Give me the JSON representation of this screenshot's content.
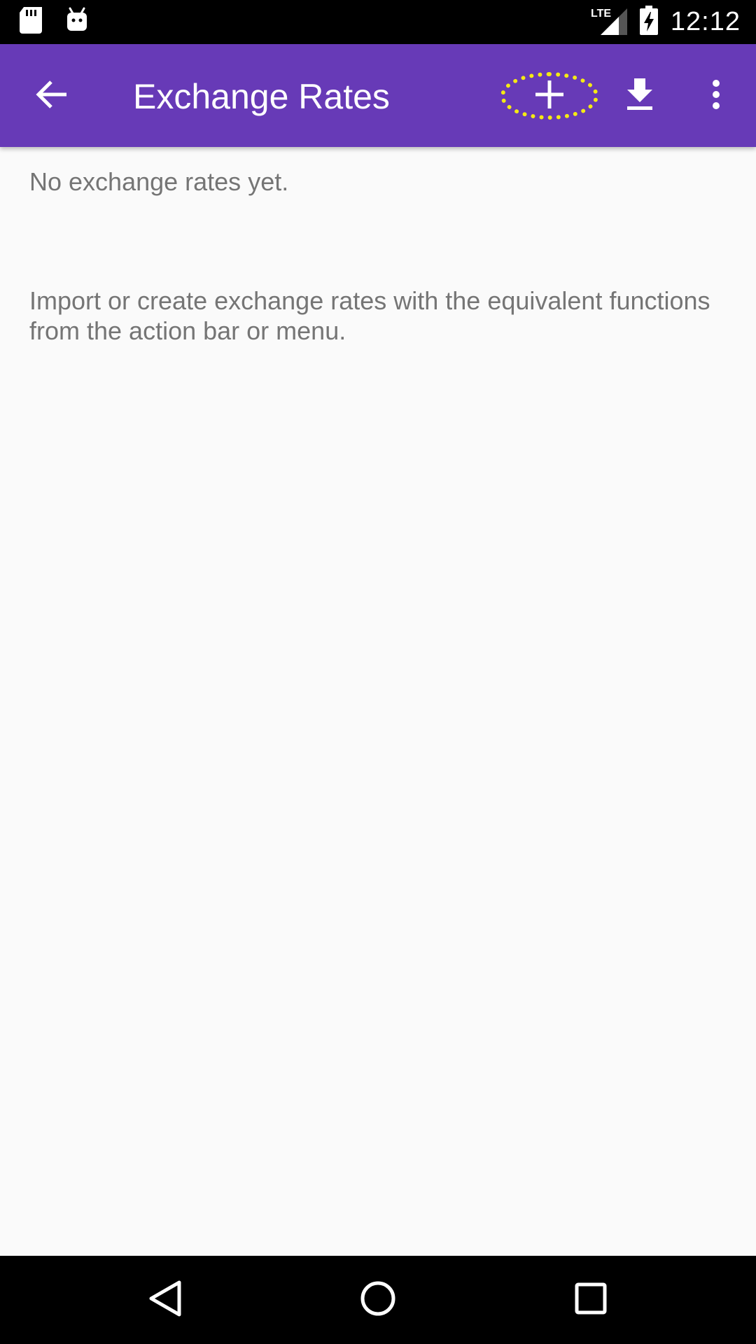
{
  "status_bar": {
    "time": "12:12",
    "network": "LTE",
    "icons": [
      "sd-card-icon",
      "android-icon",
      "signal-icon",
      "battery-charging-icon"
    ]
  },
  "app_bar": {
    "title": "Exchange Rates",
    "background_color": "#673ab7",
    "actions": [
      "back-arrow-icon",
      "add-icon",
      "download-icon",
      "more-vert-icon"
    ],
    "highlight_color": "#f5ea14"
  },
  "content": {
    "empty_title": "No exchange rates yet.",
    "empty_hint": "Import or create exchange rates with the equivalent functions from the action bar or menu."
  },
  "nav_bar": {
    "buttons": [
      "back-triangle-icon",
      "home-circle-icon",
      "recents-square-icon"
    ]
  }
}
